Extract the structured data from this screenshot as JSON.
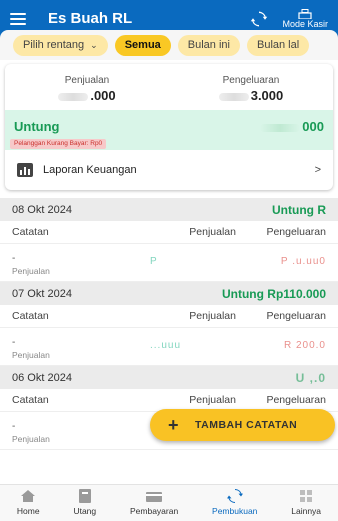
{
  "app": {
    "title": "Es Buah RL",
    "mode_label": "Mode Kasir"
  },
  "filters": {
    "range_label": "Pilih rentang",
    "chips": [
      "Semua",
      "Bulan ini",
      "Bulan lal"
    ]
  },
  "summary": {
    "sales_label": "Penjualan",
    "sales_value": ".000",
    "expense_label": "Pengeluaran",
    "expense_value": "3.000",
    "profit_label": "Untung",
    "profit_value": "000",
    "debt_label": "Pelanggan Kurang Bayar: Rp0",
    "report_label": "Laporan Keuangan",
    "report_arrow": ">"
  },
  "columns": {
    "note": "Catatan",
    "sales": "Penjualan",
    "expense": "Pengeluaran"
  },
  "days": [
    {
      "date": "08 Okt 2024",
      "profit": "Untung R",
      "entry": {
        "dash": "-",
        "sub": "Penjualan",
        "sales": "P",
        "expense": "P .u.uu0"
      }
    },
    {
      "date": "07 Okt 2024",
      "profit": "Untung Rp110.000",
      "entry": {
        "dash": "-",
        "sub": "Penjualan",
        "sales": "...uuu",
        "expense": "R 200.0"
      }
    },
    {
      "date": "06 Okt 2024",
      "profit": "U    ,.0",
      "entry": {
        "dash": "-",
        "sub": "Penjualan",
        "sales": "",
        "expense": ""
      }
    }
  ],
  "fab": {
    "plus": "+",
    "label": "TAMBAH CATATAN"
  },
  "nav": [
    {
      "label": "Home",
      "icon": "home-icon"
    },
    {
      "label": "Utang",
      "icon": "debt-book-icon"
    },
    {
      "label": "Pembayaran",
      "icon": "payment-icon"
    },
    {
      "label": "Pembukuan",
      "icon": "bookkeeping-icon",
      "active": true
    },
    {
      "label": "Lainnya",
      "icon": "more-grid-icon"
    }
  ],
  "colors": {
    "primary": "#0a6abf",
    "accent": "#f9c824",
    "profit": "#189a55",
    "sales": "#1bb38a",
    "expense": "#d8342d"
  }
}
